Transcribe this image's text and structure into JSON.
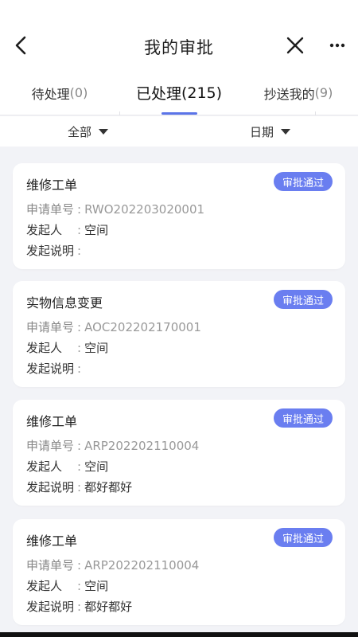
{
  "nav": {
    "title": "我的审批"
  },
  "tabs": [
    {
      "label": "待处理",
      "count": "(0)"
    },
    {
      "label": "已处理",
      "count": "(215)"
    },
    {
      "label": "抄送我的",
      "count": "(9)"
    }
  ],
  "filters": {
    "all": "全部",
    "date": "日期"
  },
  "labels": {
    "order_no": "申请单号",
    "initiator": "发起人",
    "description": "发起说明",
    "colon": ":"
  },
  "cards": [
    {
      "title": "维修工单",
      "status": "审批通过",
      "order_no": "RWO202203020001",
      "initiator": "空间",
      "description": ""
    },
    {
      "title": "实物信息变更",
      "status": "审批通过",
      "order_no": "AOC202202170001",
      "initiator": "空间",
      "description": ""
    },
    {
      "title": "维修工单",
      "status": "审批通过",
      "order_no": "ARP202202110004",
      "initiator": "空间",
      "description": "都好都好"
    },
    {
      "title": "维修工单",
      "status": "审批通过",
      "order_no": "ARP202202110004",
      "initiator": "空间",
      "description": "都好都好"
    }
  ],
  "colors": {
    "accent": "#5b74e8",
    "badge": "#6a7ef0",
    "background": "#f2f3f7"
  },
  "icons": {
    "back": "chevron-left-icon",
    "close": "close-icon",
    "more": "more-dots-icon",
    "filter_caret": "caret-down-icon"
  }
}
